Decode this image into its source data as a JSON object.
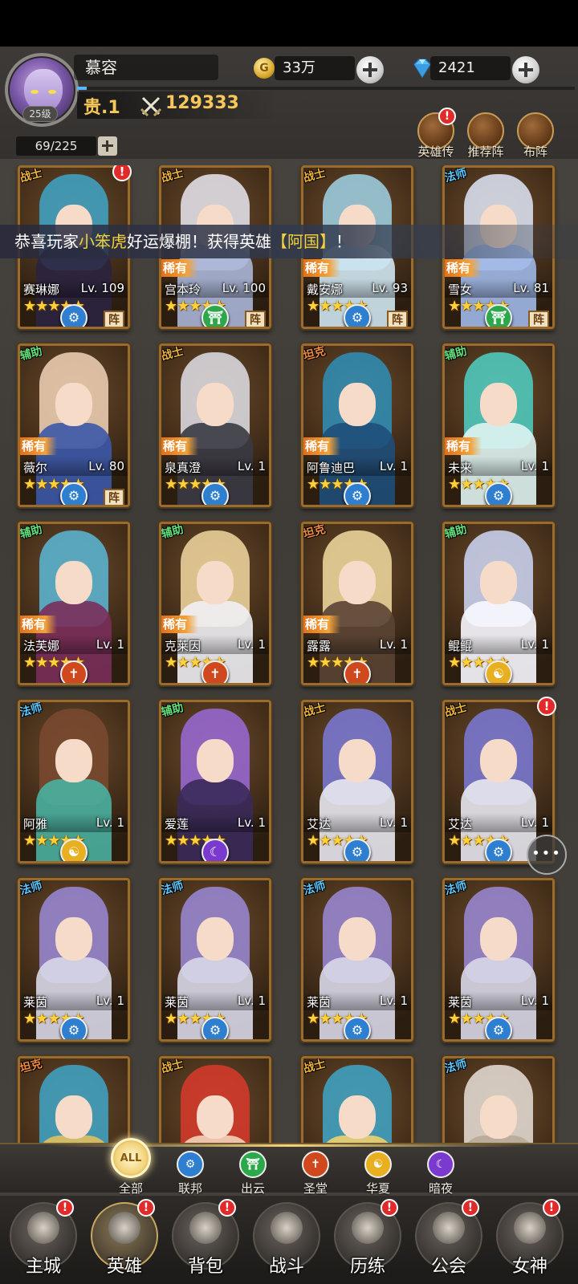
{
  "player": {
    "name": "慕容",
    "level": "25级",
    "rank": "贵.1",
    "power": "129333",
    "exp_fraction": 0.02
  },
  "resources": {
    "gold": "33万",
    "gold_icon": "G",
    "gems": "2421"
  },
  "capacity": "69/225",
  "top_actions": [
    {
      "label": "英雄传",
      "icon": "crown-icon",
      "alert": "!"
    },
    {
      "label": "推荐阵",
      "icon": "thumbs-up-icon"
    },
    {
      "label": "布阵",
      "icon": "horse-icon"
    }
  ],
  "banner": {
    "prefix": "恭喜玩家",
    "player": "小笨虎",
    "middle": "好运爆棚！获得英雄",
    "hero": "【阿国】",
    "suffix": "！"
  },
  "heroes": [
    {
      "cls": "战士",
      "name": "赛琳娜",
      "lv": "Lv. 109",
      "rare": "",
      "stars": 5,
      "faction": "联邦",
      "formation": "阵",
      "alert": "!",
      "colors": [
        "#3fa6c8",
        "#2b2340"
      ]
    },
    {
      "cls": "战士",
      "name": "宫本玲",
      "lv": "Lv. 100",
      "rare": "稀有",
      "stars": 5,
      "faction": "出云",
      "formation": "阵",
      "colors": [
        "#e8e8f0",
        "#a8b6d8"
      ]
    },
    {
      "cls": "战士",
      "name": "戴安娜",
      "lv": "Lv. 93",
      "rare": "稀有",
      "stars": 5,
      "faction": "联邦",
      "formation": "阵",
      "colors": [
        "#9fd2e6",
        "#cfe7f2"
      ]
    },
    {
      "cls": "法师",
      "name": "雪女",
      "lv": "Lv. 81",
      "rare": "稀有",
      "stars": 5,
      "faction": "出云",
      "formation": "阵",
      "colors": [
        "#dfe8f8",
        "#9fb8e8"
      ]
    },
    {
      "cls": "辅助",
      "name": "薇尔",
      "lv": "Lv. 80",
      "rare": "稀有",
      "stars": 5,
      "faction": "联邦",
      "formation": "阵",
      "colors": [
        "#f2d4b8",
        "#3b58a8"
      ]
    },
    {
      "cls": "战士",
      "name": "泉真澄",
      "lv": "Lv. 1",
      "rare": "稀有",
      "stars": 5,
      "faction": "联邦",
      "formation": "",
      "colors": [
        "#e0e0e8",
        "#3a3a44"
      ]
    },
    {
      "cls": "坦克",
      "name": "阿鲁迪巴",
      "lv": "Lv. 1",
      "rare": "稀有",
      "stars": 5,
      "faction": "联邦",
      "formation": "",
      "colors": [
        "#2f8fb8",
        "#1e4e7a"
      ]
    },
    {
      "cls": "辅助",
      "name": "未来",
      "lv": "Lv. 1",
      "rare": "稀有",
      "stars": 5,
      "faction": "联邦",
      "formation": "",
      "colors": [
        "#4fd0c6",
        "#dff4f2"
      ]
    },
    {
      "cls": "辅助",
      "name": "法芙娜",
      "lv": "Lv. 1",
      "rare": "稀有",
      "stars": 5,
      "faction": "圣堂",
      "formation": "",
      "colors": [
        "#59b8d8",
        "#7a2f5a"
      ]
    },
    {
      "cls": "辅助",
      "name": "克莱因",
      "lv": "Lv. 1",
      "rare": "稀有",
      "stars": 5,
      "faction": "圣堂",
      "formation": "",
      "colors": [
        "#f2d8a0",
        "#f0f0f4"
      ]
    },
    {
      "cls": "坦克",
      "name": "露露",
      "lv": "Lv. 1",
      "rare": "稀有",
      "stars": 5,
      "faction": "圣堂",
      "formation": "",
      "colors": [
        "#f2dca0",
        "#5a4434"
      ]
    },
    {
      "cls": "辅助",
      "name": "鲲鲲",
      "lv": "Lv. 1",
      "rare": "",
      "stars": 5,
      "faction": "华夏",
      "formation": "",
      "colors": [
        "#cfd8f8",
        "#f8f8ff"
      ]
    },
    {
      "cls": "法师",
      "name": "阿雅",
      "lv": "Lv. 1",
      "rare": "",
      "stars": 5,
      "faction": "华夏",
      "formation": "",
      "colors": [
        "#7a4a30",
        "#4ab0a0"
      ]
    },
    {
      "cls": "辅助",
      "name": "爱莲",
      "lv": "Lv. 1",
      "rare": "",
      "stars": 5,
      "faction": "暗夜",
      "formation": "",
      "colors": [
        "#9a6ad8",
        "#3a2a5a"
      ]
    },
    {
      "cls": "战士",
      "name": "艾达",
      "lv": "Lv. 1",
      "rare": "",
      "stars": 5,
      "faction": "联邦",
      "formation": "",
      "colors": [
        "#7a7ad8",
        "#e8e8f0"
      ]
    },
    {
      "cls": "战士",
      "name": "艾达",
      "lv": "Lv. 1",
      "rare": "",
      "stars": 5,
      "faction": "联邦",
      "formation": "",
      "alert": "!",
      "colors": [
        "#7a7ad8",
        "#e8e8f0"
      ]
    },
    {
      "cls": "法师",
      "name": "莱茵",
      "lv": "Lv. 1",
      "rare": "",
      "stars": 5,
      "faction": "联邦",
      "formation": "",
      "colors": [
        "#9a8ad8",
        "#d8d8e8"
      ]
    },
    {
      "cls": "法师",
      "name": "莱茵",
      "lv": "Lv. 1",
      "rare": "",
      "stars": 5,
      "faction": "联邦",
      "formation": "",
      "colors": [
        "#9a8ad8",
        "#d8d8e8"
      ]
    },
    {
      "cls": "法师",
      "name": "莱茵",
      "lv": "Lv. 1",
      "rare": "",
      "stars": 5,
      "faction": "联邦",
      "formation": "",
      "colors": [
        "#9a8ad8",
        "#d8d8e8"
      ]
    },
    {
      "cls": "法师",
      "name": "莱茵",
      "lv": "Lv. 1",
      "rare": "",
      "stars": 5,
      "faction": "联邦",
      "formation": "",
      "colors": [
        "#9a8ad8",
        "#d8d8e8"
      ]
    },
    {
      "cls": "坦克",
      "name": "",
      "lv": "",
      "rare": "",
      "stars": 0,
      "faction": "",
      "formation": "",
      "colors": [
        "#3fa6c8",
        "#e0c060"
      ]
    },
    {
      "cls": "战士",
      "name": "",
      "lv": "",
      "rare": "",
      "stars": 0,
      "faction": "",
      "formation": "",
      "colors": [
        "#d83a2a",
        "#f2d4b8"
      ]
    },
    {
      "cls": "战士",
      "name": "",
      "lv": "",
      "rare": "",
      "stars": 0,
      "faction": "",
      "formation": "",
      "colors": [
        "#3fa6c8",
        "#f0d070"
      ]
    },
    {
      "cls": "法师",
      "name": "",
      "lv": "",
      "rare": "",
      "stars": 0,
      "faction": "",
      "formation": "",
      "colors": [
        "#e8e0d8",
        "#b8a898"
      ]
    }
  ],
  "class_colors": {
    "战士": "#f3b63a",
    "法师": "#5cc8ff",
    "辅助": "#62e07a",
    "坦克": "#f08a3a"
  },
  "faction_colors": {
    "联邦": "#2f7fd0",
    "出云": "#2aa84a",
    "圣堂": "#d0481e",
    "华夏": "#e8b020",
    "暗夜": "#7a3ad0"
  },
  "faction_glyphs": {
    "联邦": "⚙",
    "出云": "⛩",
    "圣堂": "✝",
    "华夏": "☯",
    "暗夜": "☾"
  },
  "filters": [
    {
      "label": "全部",
      "glyph": "ALL",
      "active": true
    },
    {
      "label": "联邦",
      "glyph": "⚙"
    },
    {
      "label": "出云",
      "glyph": "⛩"
    },
    {
      "label": "圣堂",
      "glyph": "✝"
    },
    {
      "label": "华夏",
      "glyph": "☯"
    },
    {
      "label": "暗夜",
      "glyph": "☾"
    }
  ],
  "nav": [
    {
      "label": "主城",
      "icon": "castle-icon",
      "alert": "!"
    },
    {
      "label": "英雄",
      "icon": "hood-icon",
      "alert": "!",
      "active": true
    },
    {
      "label": "背包",
      "icon": "backpack-icon",
      "alert": "!"
    },
    {
      "label": "战斗",
      "icon": "crossed-swords-icon"
    },
    {
      "label": "历练",
      "icon": "map-icon",
      "alert": "!"
    },
    {
      "label": "公会",
      "icon": "shield-icon",
      "alert": "!"
    },
    {
      "label": "女神",
      "icon": "goddess-icon",
      "alert": "!"
    }
  ]
}
